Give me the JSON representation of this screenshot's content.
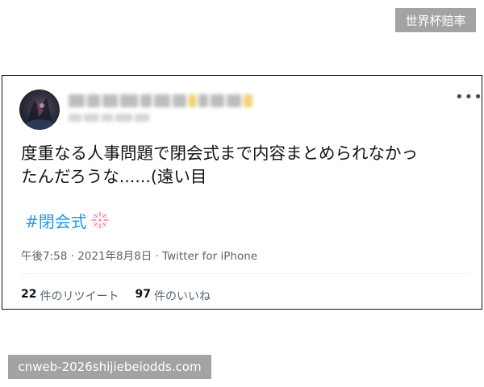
{
  "watermark_top": "世界杯赔率",
  "watermark_bottom": "cnweb-2026shijiebeiodds.com",
  "tweet": {
    "text_line1": "度重なる人事問題で閉会式まで内容まとめられなかっ",
    "text_line2": "たんだろうな......(遠い目",
    "hashtag": "#閉会式",
    "time": "午後7:58",
    "separator": " · ",
    "date": "2021年8月8日",
    "source": "Twitter for iPhone",
    "retweet_count": "22",
    "retweet_label": "件のリツイート",
    "like_count": "97",
    "like_label": "件のいいね",
    "more_icon": "more-horizontal-icon"
  },
  "colors": {
    "link": "#1d9bf0",
    "meta": "#536471",
    "text": "#0f1419",
    "badge_bg": "#a3a3a3"
  }
}
